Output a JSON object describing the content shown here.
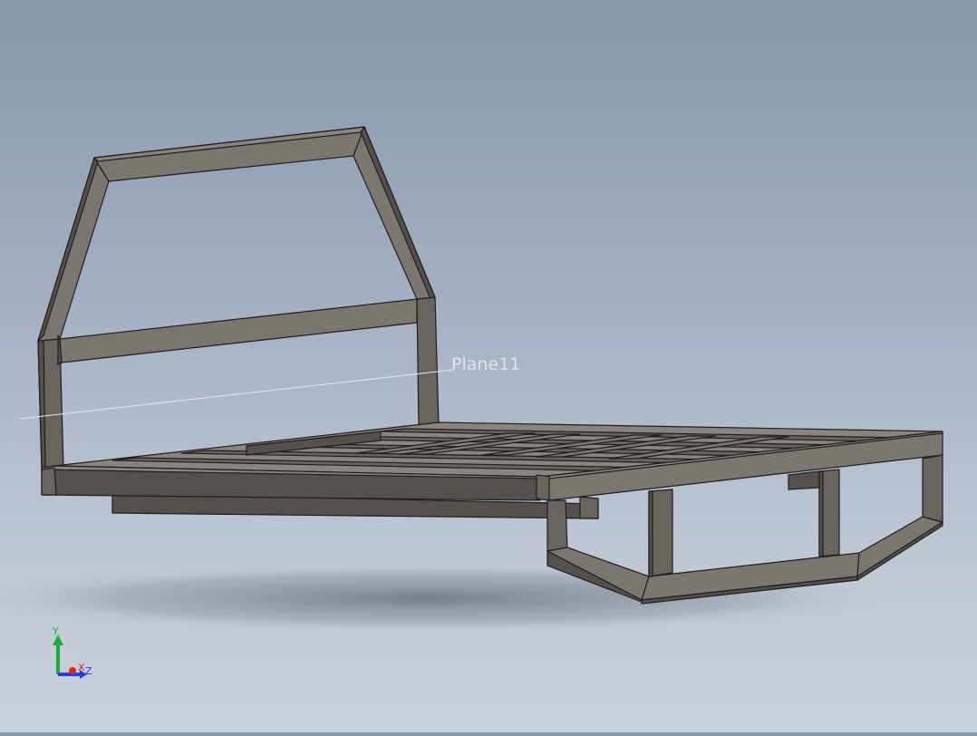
{
  "viewport": {
    "plane_label": "Plane11",
    "triad": {
      "y_label": "Y",
      "x_label": "X",
      "z_label": "Z",
      "y_color": "#1faa3a",
      "x_color": "#d8262a",
      "z_color": "#2a3fd6"
    }
  },
  "colors": {
    "background_top": "#8998ad",
    "background_bottom": "#c8d0db",
    "steel": "#6a645f"
  }
}
